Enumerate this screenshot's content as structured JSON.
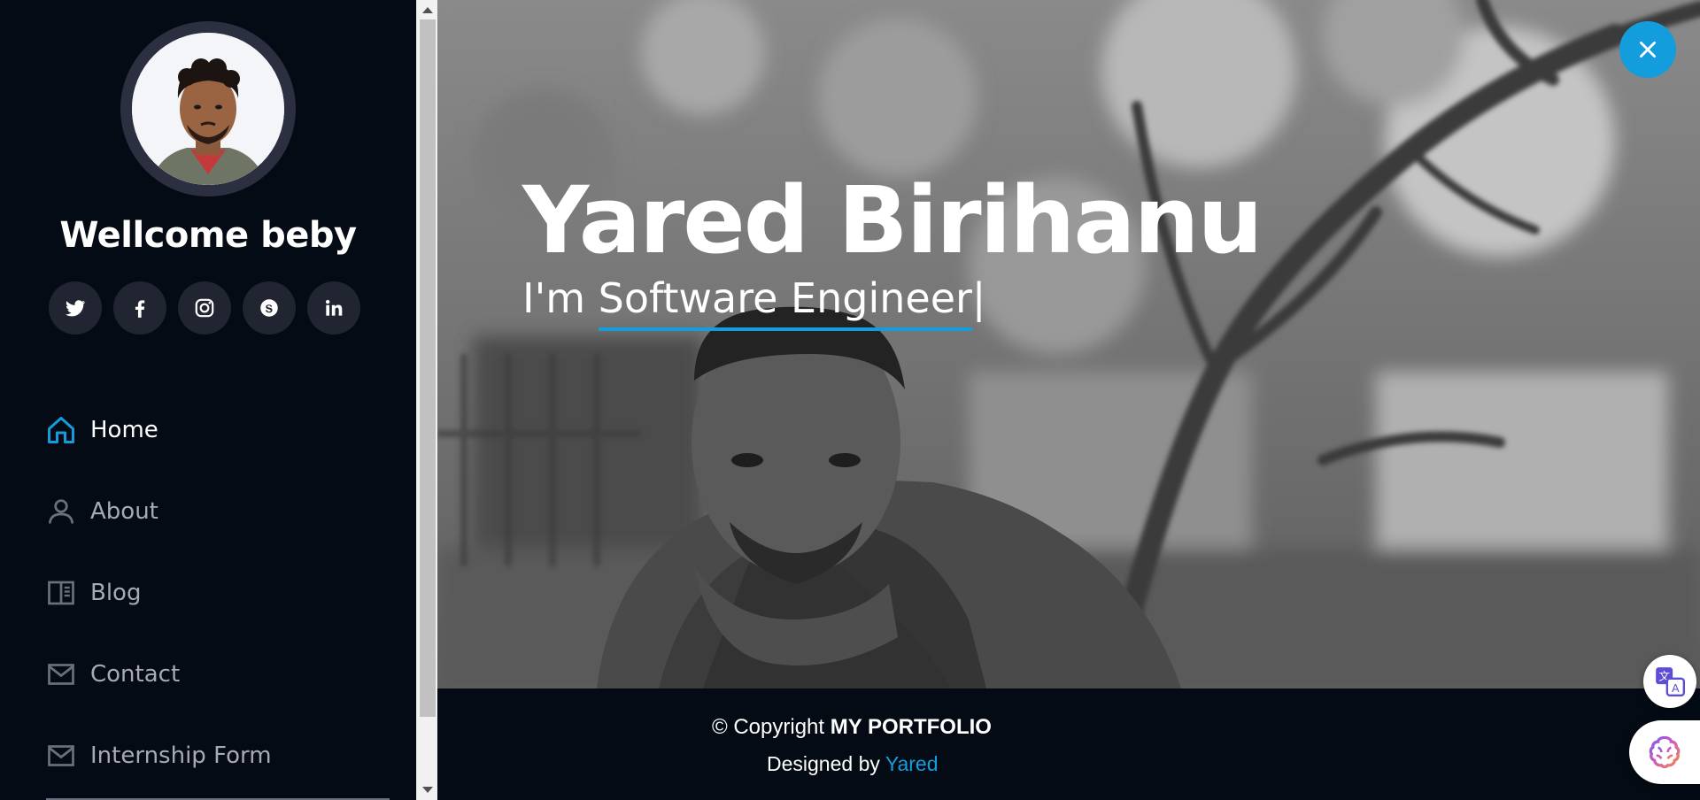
{
  "sidebar": {
    "welcome": "Wellcome beby",
    "socials": [
      {
        "icon": "twitter-icon"
      },
      {
        "icon": "facebook-icon"
      },
      {
        "icon": "instagram-icon"
      },
      {
        "icon": "skype-icon"
      },
      {
        "icon": "linkedin-icon"
      }
    ],
    "nav": [
      {
        "label": "Home",
        "icon": "home-icon",
        "active": true
      },
      {
        "label": "About",
        "icon": "person-icon"
      },
      {
        "label": "Blog",
        "icon": "book-icon"
      },
      {
        "label": "Contact",
        "icon": "envelope-icon"
      },
      {
        "label": "Internship Form",
        "icon": "envelope-icon"
      }
    ]
  },
  "hero": {
    "name": "Yared Birihanu",
    "prefix": "I'm ",
    "role": "Software Engineer",
    "cursor": "|"
  },
  "footer": {
    "copyright_prefix": "© Copyright ",
    "copyright_brand": "MY PORTFOLIO",
    "designed_prefix": "Designed by ",
    "designed_link": "Yared"
  },
  "colors": {
    "accent": "#149ddd",
    "sidebar_bg": "#040b14",
    "social_bg": "#212431",
    "nav_text": "#a8a9b4"
  }
}
